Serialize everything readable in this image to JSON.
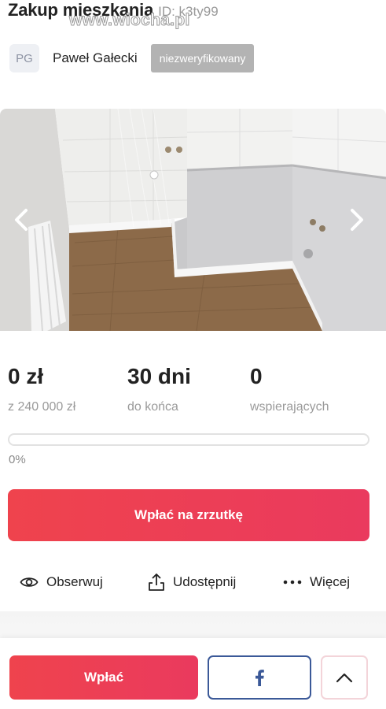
{
  "campaign": {
    "title": "Zakup mieszkania",
    "id_text": "ID: k3ty99"
  },
  "watermark": "www.wiocha.pl",
  "author": {
    "initials": "PG",
    "name": "Paweł Gałecki",
    "badge": "niezweryfikowany"
  },
  "gallery": {
    "image_icon": "bathroom-photo",
    "prev_icon": "chevron-left-icon",
    "next_icon": "chevron-right-icon"
  },
  "stats": {
    "raised_value": "0 zł",
    "raised_label": "z 240 000 zł",
    "days_value": "30 dni",
    "days_label": "do końca",
    "supporters_value": "0",
    "supporters_label": "wspierających"
  },
  "progress": {
    "percent": 0,
    "text": "0%"
  },
  "cta": {
    "label": "Wpłać na zrzutkę"
  },
  "actions": {
    "follow_label": "Obserwuj",
    "share_label": "Udostępnij",
    "more_label": "Więcej"
  },
  "bottom_bar": {
    "pay_label": "Wpłać",
    "facebook_icon": "facebook-icon",
    "up_icon": "chevron-up-icon"
  },
  "colors": {
    "accent": "#ee3b4f",
    "facebook": "#3b5998",
    "muted": "#9a9a9a"
  }
}
